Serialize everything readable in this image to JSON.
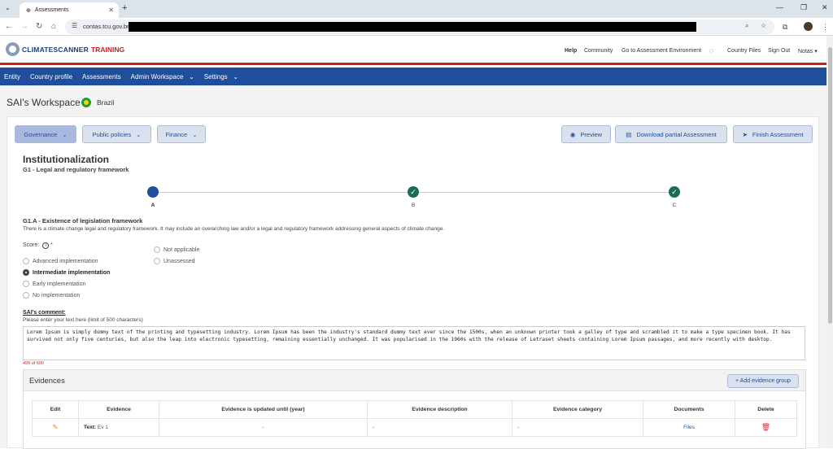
{
  "browser": {
    "tab_title": "Assessments",
    "url": "contas.tcu.gov.br/"
  },
  "app": {
    "logo_main": "CLIMATESCANNER",
    "logo_sub": "TRAINING",
    "top_links": {
      "help": "Help",
      "community": "Community",
      "assessment_env": "Go to Assessment Environment",
      "country_files": "Country Files",
      "sign_out": "Sign Out",
      "notas": "Notas"
    },
    "nav": [
      "Entity",
      "Country profile",
      "Assessments",
      "Admin Workspace",
      "Settings"
    ]
  },
  "workspace": {
    "title": "SAI's Workspace",
    "country": "Brazil"
  },
  "toolbar": {
    "governance": "Governance",
    "public_policies": "Public policies",
    "finance": "Finance",
    "preview": "Preview",
    "download": "Download partial Assessment",
    "finish": "Finish Assessment"
  },
  "section": {
    "title": "Institutionalization",
    "subtitle": "G1 - Legal and regulatory framework"
  },
  "steps": [
    "A",
    "B",
    "C"
  ],
  "question": {
    "title": "G1.A - Existence of legislation framework",
    "description": "There is a climate change legal and regulatory framework. It may include an overarching law and/or a legal and regulatory framework addressing general aspects of climate change.",
    "score_label": "Score:",
    "options_left": [
      "Advanced implementation",
      "Intermediate implementation",
      "Early implementation",
      "No implementation"
    ],
    "options_right": [
      "Not applicable",
      "Unassessed"
    ],
    "selected": "Intermediate implementation"
  },
  "comment": {
    "label": "SAI's comment:",
    "hint": "Please enter your text here (limit of 500 characters)",
    "text": "Lorem Ipsum is simply dummy text of the printing and typesetting industry. Lorem Ipsum has been the industry's standard dummy text ever since the 1500s, when an unknown printer took a galley of type and scrambled it to make a type specimen book. It has survived not only five centuries, but also the leap into electronic typesetting, remaining essentially unchanged. It was popularised in the 1960s with the release of Letraset sheets containing Lorem Ipsum passages, and more recently with desktop.",
    "counter": "499 of 500"
  },
  "evidences": {
    "title": "Evidences",
    "add_button": "+ Add evidence group",
    "columns": [
      "Edit",
      "Evidence",
      "Evidence is updated until (year)",
      "Evidence description",
      "Evidence category",
      "Documents",
      "Delete"
    ],
    "rows": [
      {
        "evidence_type": "Text:",
        "evidence_value": "Ev 1",
        "updated": "-",
        "description": "-",
        "category": "-",
        "documents": "Files"
      }
    ]
  },
  "colors": {
    "nav_blue": "#1f4e9c",
    "brand_red": "#c91f1f",
    "done_green": "#1c6b5a"
  }
}
